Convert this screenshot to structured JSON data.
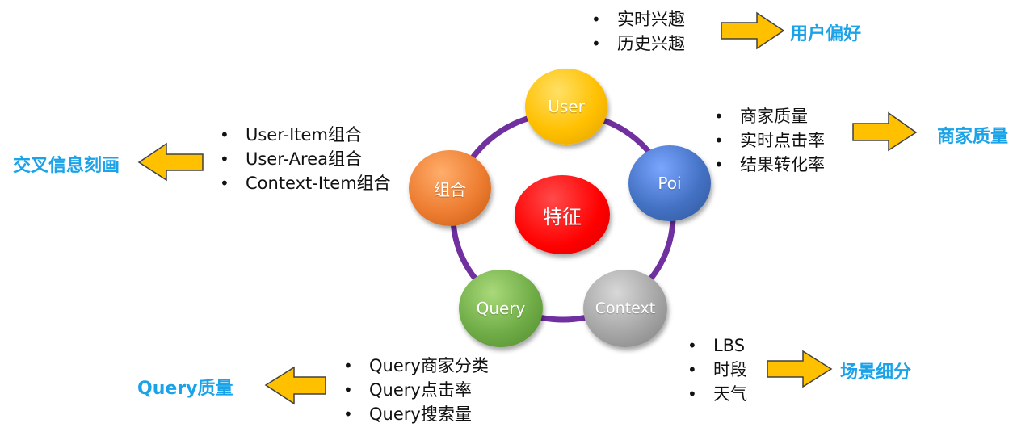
{
  "center": {
    "label": "特征"
  },
  "nodes": {
    "user": {
      "label": "User"
    },
    "poi": {
      "label": "Poi"
    },
    "context": {
      "label": "Context"
    },
    "query": {
      "label": "Query"
    },
    "combo": {
      "label": "组合"
    }
  },
  "user_features": [
    "实时兴趣",
    "历史兴趣"
  ],
  "poi_features": [
    "商家质量",
    "实时点击率",
    "结果转化率"
  ],
  "context_features": [
    "LBS",
    "时段",
    "天气"
  ],
  "query_features": [
    "Query商家分类",
    "Query点击率",
    "Query搜索量"
  ],
  "combo_features": [
    "User-Item组合",
    "User-Area组合",
    "Context-Item组合"
  ],
  "outcomes": {
    "user": "用户偏好",
    "poi": "商家质量",
    "context": "场景细分",
    "query": "Query质量",
    "combo": "交叉信息刻画"
  },
  "bullet": "•",
  "colors": {
    "ring": "#7030a0",
    "arrow_fill": "#ffc000",
    "arrow_stroke": "#404040",
    "outcome_text": "#1aa3e8"
  }
}
